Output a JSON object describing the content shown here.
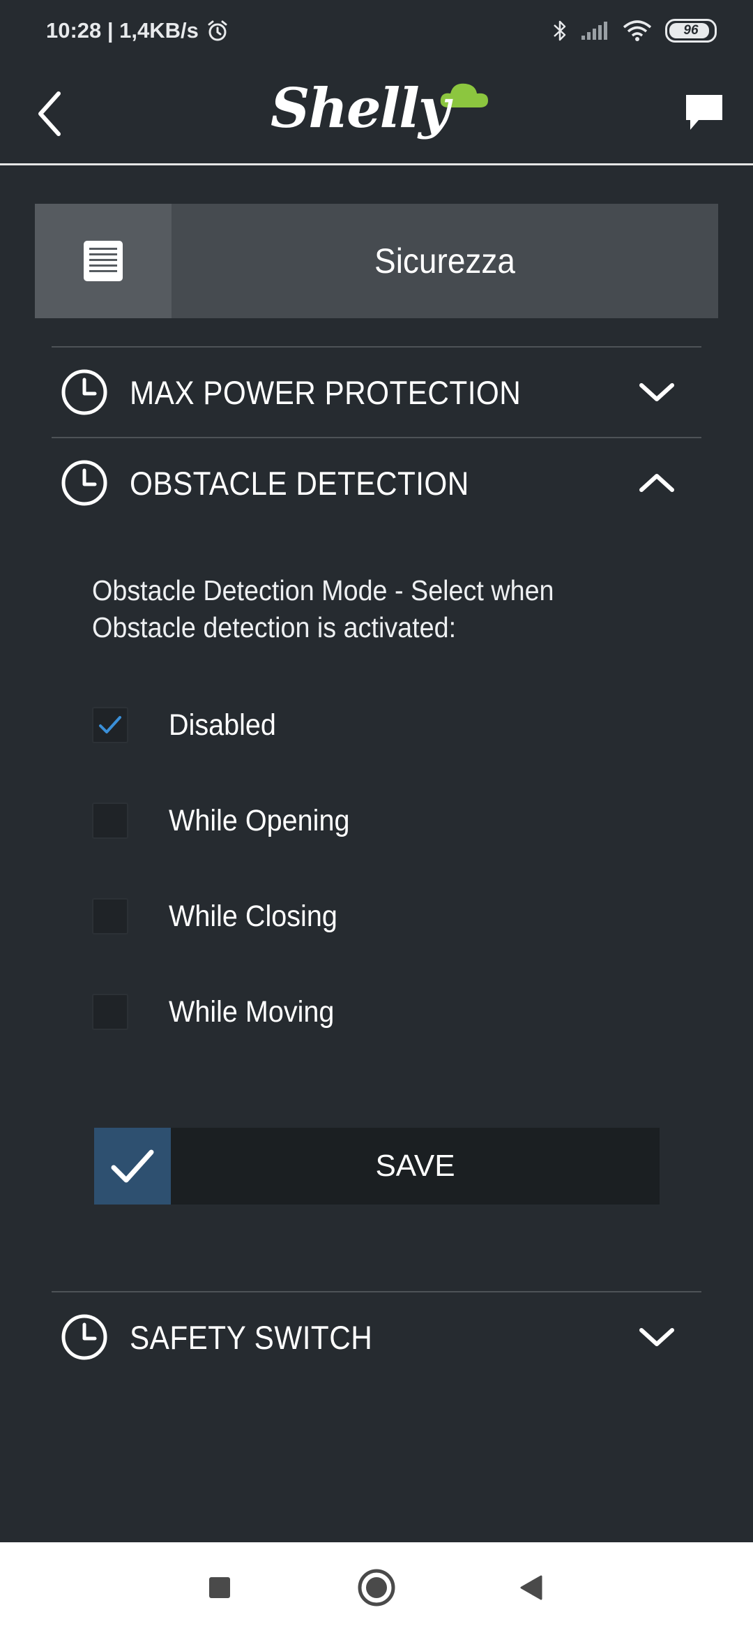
{
  "status_bar": {
    "time_speed": "10:28 | 1,4KB/s",
    "battery": "96",
    "icons": [
      "alarm-icon",
      "bluetooth-icon",
      "signal-icon",
      "wifi-icon",
      "battery-icon"
    ]
  },
  "header": {
    "logo_text": "Shelly",
    "icons": [
      "back-arrow-icon",
      "chat-icon"
    ]
  },
  "section": {
    "title": "Sicurezza",
    "icon": "document-list-icon"
  },
  "accordion": {
    "max_power": {
      "label": "MAX POWER PROTECTION",
      "expanded": false
    },
    "obstacle": {
      "label": "OBSTACLE DETECTION",
      "expanded": true,
      "description": "Obstacle Detection Mode - Select when Obstacle detection is activated:",
      "options": [
        {
          "label": "Disabled",
          "checked": true
        },
        {
          "label": "While Opening",
          "checked": false
        },
        {
          "label": "While Closing",
          "checked": false
        },
        {
          "label": "While Moving",
          "checked": false
        }
      ],
      "save_label": "SAVE"
    },
    "safety_switch": {
      "label": "SAFETY SWITCH",
      "expanded": false
    }
  },
  "colors": {
    "background": "#262b30",
    "accent": "#2e5070",
    "checkmark": "#3a8fd8",
    "logo_cloud": "#8cc63f"
  }
}
